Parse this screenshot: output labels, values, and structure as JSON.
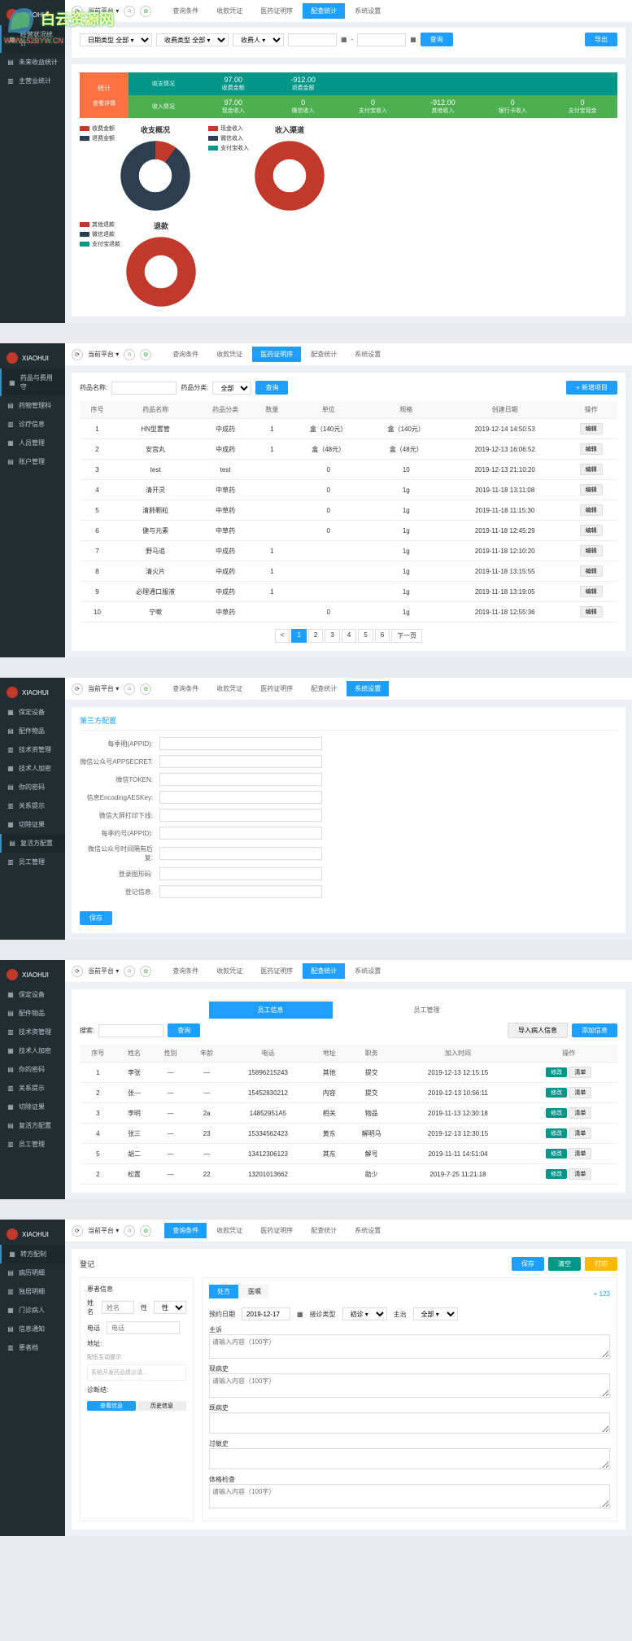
{
  "watermark": {
    "text": "白云资源网",
    "url": "WWW.52BYW.CN"
  },
  "users": {
    "name": "XIAOHUI"
  },
  "panel1": {
    "sidebar": [
      {
        "icon": "▦",
        "label": "经营状况统计"
      },
      {
        "icon": "▤",
        "label": "未来收益统计"
      },
      {
        "icon": "▥",
        "label": "主营业统计"
      }
    ],
    "filters": {
      "l1": "日期类型 全部 ▾",
      "l2": "收费类型 全部 ▾",
      "l3": "收费人 ▾",
      "btn_search": "查询",
      "btn_export": "导出"
    },
    "tabs": [
      "查询条件",
      "收款凭证",
      "医药证明序",
      "配查统计",
      "系统设置"
    ],
    "stat_left": {
      "t1": "统计",
      "t2": "查看详情"
    },
    "stat_top": {
      "label": "收支情况",
      "cells": [
        {
          "l": "收费金额",
          "v": "97.00"
        },
        {
          "l": "退费金额",
          "v": "-912.00"
        }
      ]
    },
    "stat_mid": {
      "l": "收入情况",
      "cells": [
        {
          "l": "现金收入",
          "v": "97.00"
        },
        {
          "l": "微信收入",
          "v": "0"
        },
        {
          "l": "支付宝收入",
          "v": "0"
        },
        {
          "l": "其他收入",
          "v": "-912.00"
        },
        {
          "l": "银行卡收入",
          "v": "0"
        },
        {
          "l": "支付宝现金",
          "v": "0"
        }
      ]
    },
    "chart_titles": {
      "c1": "收支概况",
      "c2": "收入渠道",
      "c3": "退款"
    },
    "legends": {
      "c1": [
        {
          "c": "#c0392b",
          "t": "收费金额"
        },
        {
          "c": "#2c3e50",
          "t": "退费金额"
        }
      ],
      "c2": [
        {
          "c": "#c0392b",
          "t": "现金收入"
        },
        {
          "c": "#2c3e50",
          "t": "微信收入"
        },
        {
          "c": "#009688",
          "t": "支付宝收入"
        }
      ],
      "c3": [
        {
          "c": "#c0392b",
          "t": "其他退款"
        },
        {
          "c": "#2c3e50",
          "t": "微信退款"
        },
        {
          "c": "#009688",
          "t": "支付宝退款"
        }
      ]
    }
  },
  "chart_data": [
    {
      "type": "pie",
      "title": "收支概况",
      "series": [
        {
          "name": "收费金额",
          "value": 97,
          "color": "#c0392b"
        },
        {
          "name": "退费金额",
          "value": 912,
          "color": "#2c3e50"
        }
      ]
    },
    {
      "type": "pie",
      "title": "收入渠道",
      "series": [
        {
          "name": "现金收入",
          "value": 97,
          "color": "#c0392b"
        },
        {
          "name": "微信收入",
          "value": 0,
          "color": "#2c3e50"
        },
        {
          "name": "支付宝收入",
          "value": 0,
          "color": "#009688"
        }
      ]
    },
    {
      "type": "pie",
      "title": "退款",
      "series": [
        {
          "name": "其他退款",
          "value": 912,
          "color": "#c0392b"
        },
        {
          "name": "微信退款",
          "value": 0,
          "color": "#2c3e50"
        },
        {
          "name": "支付宝退款",
          "value": 0,
          "color": "#009688"
        }
      ]
    }
  ],
  "panel2": {
    "sidebar": [
      {
        "icon": "▦",
        "label": "药品与费用守",
        "active": true
      },
      {
        "icon": "▤",
        "label": "药物管理科"
      },
      {
        "icon": "▥",
        "label": "诊疗信息"
      },
      {
        "icon": "▦",
        "label": "人员管理"
      },
      {
        "icon": "▤",
        "label": "账户管理"
      }
    ],
    "tabs": [
      "查询条件",
      "收款凭证",
      "医药证明序",
      "配查统计",
      "系统设置"
    ],
    "search": {
      "lbl": "药品名称:",
      "ph": "",
      "lbl2": "药品分类:",
      "opt": "全部",
      "btn": "查询",
      "btn_add": "+ 新增项目"
    },
    "cols": [
      "序号",
      "药品名称",
      "药品分类",
      "数量",
      "单位",
      "规格",
      "创建日期",
      "操作"
    ],
    "rows": [
      [
        "1",
        "HN型置管",
        "中成药",
        "1",
        "盒（140元）",
        "盒（140元）",
        "2019-12-14 14:50:53",
        "编辑"
      ],
      [
        "2",
        "安宫丸",
        "中成药",
        "1",
        "盒（48元）",
        "盒（48元）",
        "2019-12-13 16:06:52",
        "编辑"
      ],
      [
        "3",
        "test",
        "test",
        "",
        "0",
        "10",
        "2019-12-13 21:10:20",
        "编辑"
      ],
      [
        "4",
        "清开灵",
        "中草药",
        "",
        "0",
        "1g",
        "2019-11-18 13:11:08",
        "编辑"
      ],
      [
        "5",
        "清肺颗粒",
        "中草药",
        "",
        "0",
        "1g",
        "2019-11-18 11:15:30",
        "编辑"
      ],
      [
        "6",
        "健与元素",
        "中草药",
        "",
        "0",
        "1g",
        "2019-11-18 12:45:29",
        "编辑"
      ],
      [
        "7",
        "野马追",
        "中成药",
        "1",
        "",
        "1g",
        "2019-11-18 12:10:20",
        "编辑"
      ],
      [
        "8",
        "清火片",
        "中成药",
        "1",
        "",
        "1g",
        "2019-11-18 13:15:55",
        "编辑"
      ],
      [
        "9",
        "必理通口服液",
        "中成药",
        "1",
        "",
        "1g",
        "2019-11-18 13:19:05",
        "编辑"
      ],
      [
        "10",
        "宁嗽",
        "中草药",
        "",
        "0",
        "1g",
        "2019-11-18 12:55:36",
        "编辑"
      ]
    ],
    "pagination": [
      "<",
      "1",
      "2",
      "3",
      "4",
      "5",
      "6",
      "下一页"
    ]
  },
  "panel3": {
    "sidebar": [
      {
        "icon": "▦",
        "label": "保定设备"
      },
      {
        "icon": "▤",
        "label": "配件物品"
      },
      {
        "icon": "▥",
        "label": "技术资管理"
      },
      {
        "icon": "▦",
        "label": "技术人加密"
      },
      {
        "icon": "▤",
        "label": "你的密码"
      },
      {
        "icon": "▥",
        "label": "关系提示"
      },
      {
        "icon": "▦",
        "label": "切除证果"
      },
      {
        "icon": "▤",
        "label": "复活方配置",
        "active": true
      },
      {
        "icon": "▥",
        "label": "员工管理"
      }
    ],
    "tabs": [
      "查询条件",
      "收款凭证",
      "医药证明序",
      "配查统计",
      "系统设置"
    ],
    "title": "第三方配置",
    "fields": [
      "每季明(APPID):",
      "微信公众号APPSECRET:",
      "微信TOKEN:",
      "信息EncodingAESKey:",
      "微信大屏打印下线:",
      "每季约号(APPID):",
      "微信公众号时间隔有后复:",
      "登录图形码:",
      "登记信息:"
    ],
    "btn_save": "保存"
  },
  "panel4": {
    "sidebar": [
      {
        "icon": "▦",
        "label": "保定设备"
      },
      {
        "icon": "▤",
        "label": "配件物品"
      },
      {
        "icon": "▥",
        "label": "技术资管理"
      },
      {
        "icon": "▦",
        "label": "技术人加密"
      },
      {
        "icon": "▤",
        "label": "你的密码"
      },
      {
        "icon": "▥",
        "label": "关系提示"
      },
      {
        "icon": "▦",
        "label": "切除证果"
      },
      {
        "icon": "▤",
        "label": "复活方配置"
      },
      {
        "icon": "▥",
        "label": "员工管理"
      }
    ],
    "tabs": [
      "查询条件",
      "收款凭证",
      "医药证明序",
      "配查统计",
      "系统设置"
    ],
    "sub_tabs": [
      "员工信息",
      "员工管理"
    ],
    "search": {
      "lbl": "搜索:",
      "btn": "查询",
      "btn_import": "导入病人信息",
      "btn_add": "添加信息"
    },
    "cols": [
      "序号",
      "姓名",
      "性别",
      "年龄",
      "电话",
      "地址",
      "职务",
      "加入时间",
      "操作"
    ],
    "rows": [
      [
        "1",
        "李张",
        "—",
        "—",
        "15896215243",
        "其他",
        "提交",
        "2019-12-13 12:15:15",
        "修改",
        "清单"
      ],
      [
        "2",
        "张—",
        "—",
        "—",
        "15452830212",
        "内容",
        "提交",
        "2019-12-13 10:56:11",
        "修改",
        "清单"
      ],
      [
        "3",
        "李明",
        "—",
        "2a",
        "14852951A5",
        "相关",
        "物品",
        "2019-11-13 12:30:18",
        "修改",
        "清单"
      ],
      [
        "4",
        "张三",
        "—",
        "23",
        "15334562423",
        "黄东",
        "解明马",
        "2019-12-13 12:30:15",
        "修改",
        "清单"
      ],
      [
        "5",
        "胡二",
        "—",
        "—",
        "13412306123",
        "其东",
        "解号",
        "2019-11-11 14:51:04",
        "修改",
        "清单"
      ],
      [
        "2",
        "松置",
        "—",
        "22",
        "13201013662",
        "",
        "助少",
        "2019-7-25 11:21:18",
        "修改",
        "清单"
      ]
    ]
  },
  "panel5": {
    "sidebar": [
      {
        "icon": "▦",
        "label": "转方配制",
        "active": true
      },
      {
        "icon": "▤",
        "label": "病历明细"
      },
      {
        "icon": "▥",
        "label": "独居明细"
      },
      {
        "icon": "▦",
        "label": "门诊病人"
      },
      {
        "icon": "▤",
        "label": "信息通知"
      },
      {
        "icon": "▥",
        "label": "患者档"
      }
    ],
    "tabs": [
      "查询条件",
      "收款凭证",
      "医药证明序",
      "配查统计",
      "系统设置"
    ],
    "header": {
      "title": "登记",
      "btn1": "保存",
      "btn2": "清空",
      "btn3": "打印"
    },
    "left": {
      "title": "患者信息",
      "name_lbl": "姓名",
      "name_ph": "姓名",
      "sex_lbl": "性",
      "sel": "性别 ▾",
      "tel_lbl": "电话",
      "tel_ph": "电话",
      "addr_lbl": "地址:",
      "note_lbl": "配伍互动提示",
      "note": "系统开发药品建议请...",
      "diag_lbl": "诊断结:",
      "btn1": "查看信息",
      "btn2": "历史信息"
    },
    "right": {
      "tabs": [
        "处方",
        "医嘱"
      ],
      "btn_add": "+ 123",
      "date_lbl": "预约日期",
      "date_val": "2019-12-17",
      "date_ico": "▦",
      "type_lbl": "接诊类型",
      "type_val": "初诊 ▾",
      "doc_lbl": "主治",
      "doc_val": "全部 ▾",
      "f1": "主诉",
      "f1_ph": "请输入内容（100字）",
      "f2": "现病史",
      "f2_ph": "请输入内容（100字）",
      "f3": "既病史",
      "f3_ph": "",
      "f4": "过敏史",
      "f4_ph": "",
      "f5": "体格检查",
      "f5_ph": "请输入内容（100字）"
    }
  }
}
